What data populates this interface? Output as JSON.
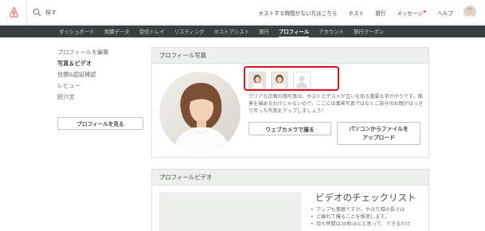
{
  "header": {
    "search_placeholder": "探す",
    "nav": [
      "ホストする時間がない方はこちら",
      "ホスト",
      "旅行",
      "メッセージ",
      "ヘルプ"
    ]
  },
  "subnav": {
    "items": [
      "ダッシュボード",
      "実績データ",
      "受信トレイ",
      "リスティング",
      "ホストアシスト",
      "旅行",
      "プロフィール",
      "アカウント",
      "旅行クーポン"
    ],
    "active": "プロフィール"
  },
  "sidebar": {
    "items": [
      "プロフィールを編集",
      "写真＆ビデオ",
      "信頼&認証確認",
      "レビュー",
      "紹介文"
    ],
    "active": "写真＆ビデオ",
    "view_profile_button": "プロフィールを見る"
  },
  "photo_panel": {
    "title": "プロフィール写真",
    "hint": "クリアな正面の顔写真は、ホストとゲストが互いを知る重要な手がかりです。風景を撮めるわけじゃないので、ここには風景写真ではなくご自分のお顔がはっきり写った写真をアップしましょう！",
    "webcam_button": "ウェブカメラで撮る",
    "upload_button_line1": "パソコンからファイルを",
    "upload_button_line2": "アップロード"
  },
  "video_panel": {
    "title": "プロフィールビデオ",
    "checklist_title": "ビデオのチェックリスト",
    "checklist": [
      "アップも素敵ですが、やはり顔の長さは",
      "ど離れて撮ることを推奨します。",
      "持ち時間は30秒ほどと思って、できるだけ"
    ]
  },
  "colors": {
    "brand": "#ff5a5f",
    "subnav_bg": "#3c3f40",
    "highlight": "#e0101e",
    "panel_header": "#edefed"
  },
  "icons": [
    "airbnb-logo",
    "search-icon",
    "notification-dot",
    "user-avatar"
  ]
}
